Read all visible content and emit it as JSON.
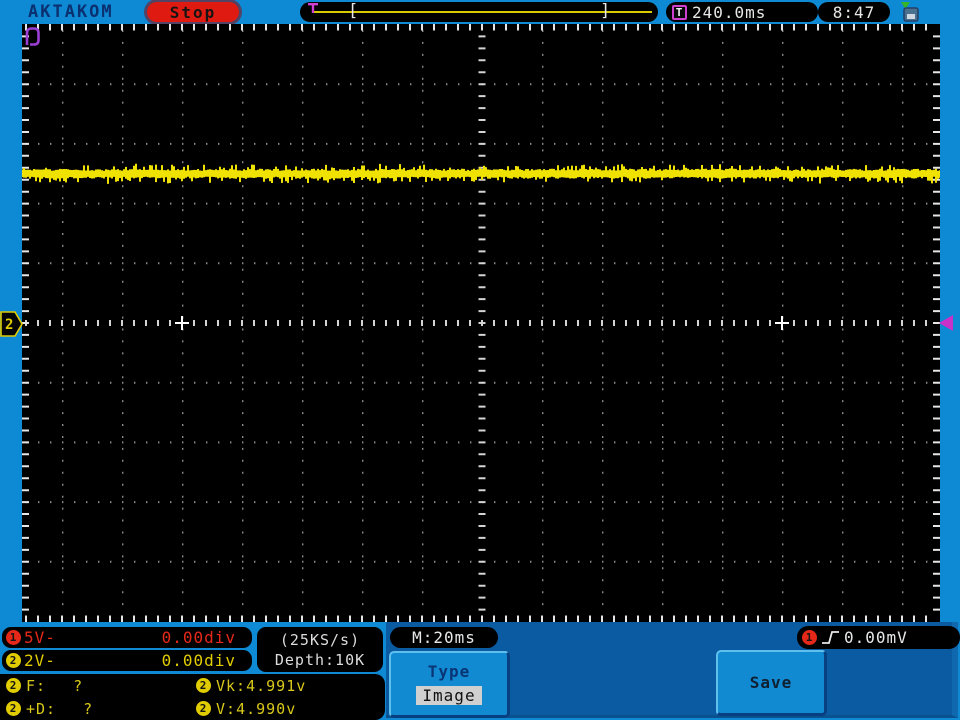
{
  "colors": {
    "blue": "#0e89d4",
    "panel": "#0b5ba2",
    "red": "#df1a10",
    "ch1": "#e62818",
    "ch2": "#e0cc00",
    "trace": "#f0e200",
    "magenta": "#c832c8"
  },
  "header": {
    "brand": "AKTAKOM",
    "run_state": "Stop",
    "trigger_marker": "T",
    "record_window": {
      "left": "[",
      "right": "]"
    },
    "trigger_delay": "240.0ms",
    "clock": "8:47"
  },
  "screen": {
    "ch2_marker_label": "2",
    "trace": {
      "channel": 2,
      "divisions_above_center": 2.5,
      "description": "flat noisy DC level"
    },
    "plus_markers_divs": [
      -5,
      5
    ]
  },
  "channels": [
    {
      "badge": "1",
      "scale": "5V-",
      "position": "0.00div"
    },
    {
      "badge": "2",
      "scale": "2V-",
      "position": "0.00div"
    }
  ],
  "acquisition": {
    "sample_rate": "(25KS/s)",
    "memory_depth": "Depth:10K",
    "timebase": "M:20ms"
  },
  "measurements": [
    {
      "badge": "2",
      "label": "F:",
      "value": "?"
    },
    {
      "badge": "2",
      "label": "Vk:",
      "value": "4.991v"
    },
    {
      "badge": "2",
      "label": "+D:",
      "value": "?"
    },
    {
      "badge": "2",
      "label": "V:",
      "value": "4.990v"
    }
  ],
  "trigger": {
    "source_badge": "1",
    "level": "0.00mV",
    "edge": "rising"
  },
  "menu": {
    "type_label": "Type",
    "type_value": "Image",
    "save_label": "Save"
  },
  "icons": {
    "storage": "usb-drive-icon",
    "edge": "rising-edge-icon",
    "trigger_position": "trigger-t-icon"
  }
}
